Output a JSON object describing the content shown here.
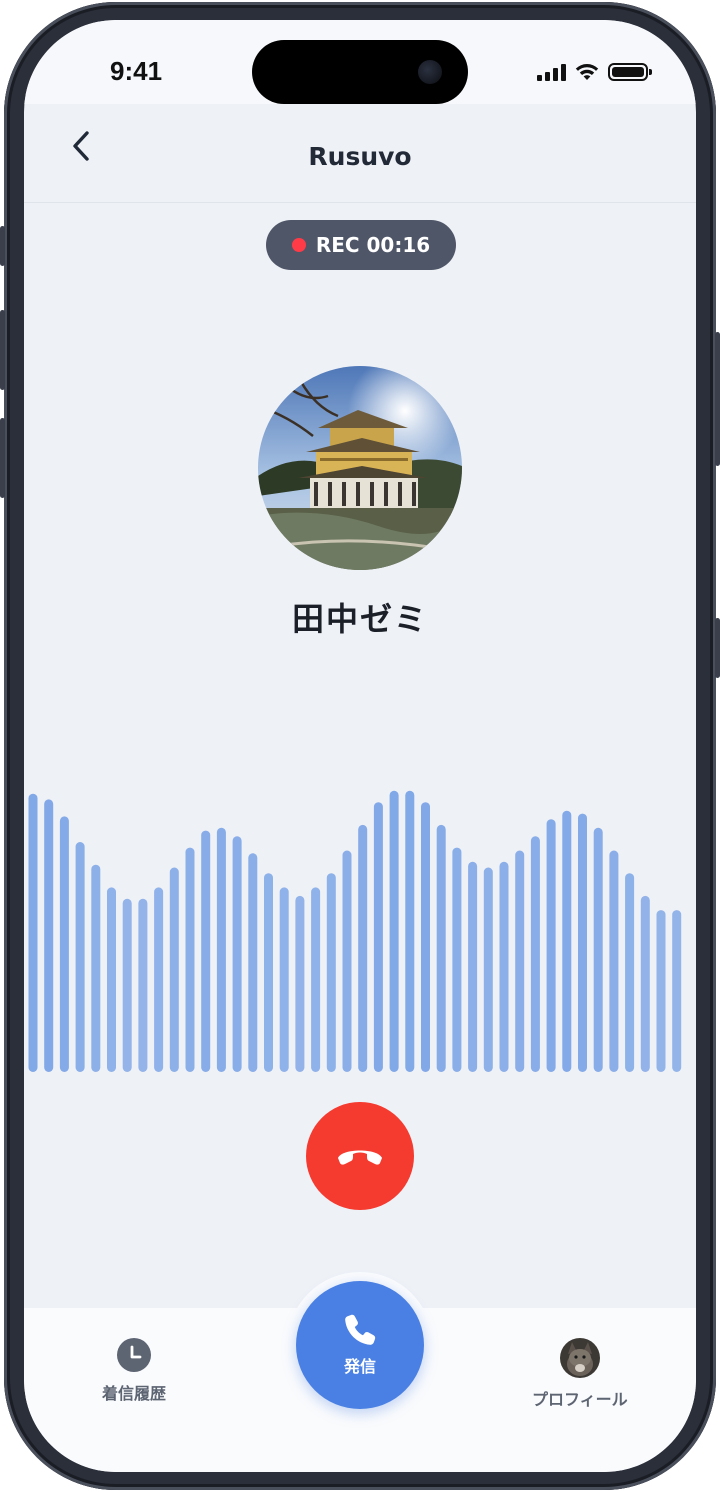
{
  "status_bar": {
    "time": "9:41"
  },
  "header": {
    "title": "Rusuvo"
  },
  "recording": {
    "label": "REC 00:16"
  },
  "contact": {
    "name": "田中ゼミ",
    "avatar": "kinkakuji-photo"
  },
  "waveform_levels": [
    0.98,
    0.96,
    0.9,
    0.81,
    0.73,
    0.65,
    0.61,
    0.61,
    0.65,
    0.72,
    0.79,
    0.85,
    0.86,
    0.83,
    0.77,
    0.7,
    0.65,
    0.62,
    0.65,
    0.7,
    0.78,
    0.87,
    0.95,
    0.99,
    0.99,
    0.95,
    0.87,
    0.79,
    0.74,
    0.72,
    0.74,
    0.78,
    0.83,
    0.89,
    0.92,
    0.91,
    0.86,
    0.78,
    0.7,
    0.62,
    0.57,
    0.57
  ],
  "colors": {
    "accent": "#4a80e3",
    "end_call": "#f53a2f",
    "rec_dot": "#ff3b48",
    "waveform": "#7aa3e6",
    "background": "#eef1f6"
  },
  "tabs": {
    "history": {
      "label": "着信履歴",
      "icon": "clock-icon"
    },
    "call": {
      "label": "発信",
      "icon": "phone-icon"
    },
    "profile": {
      "label": "プロフィール",
      "icon": "cat-avatar"
    }
  },
  "icons": {
    "back": "chevron-left-icon",
    "end_call": "hang-up-icon"
  }
}
